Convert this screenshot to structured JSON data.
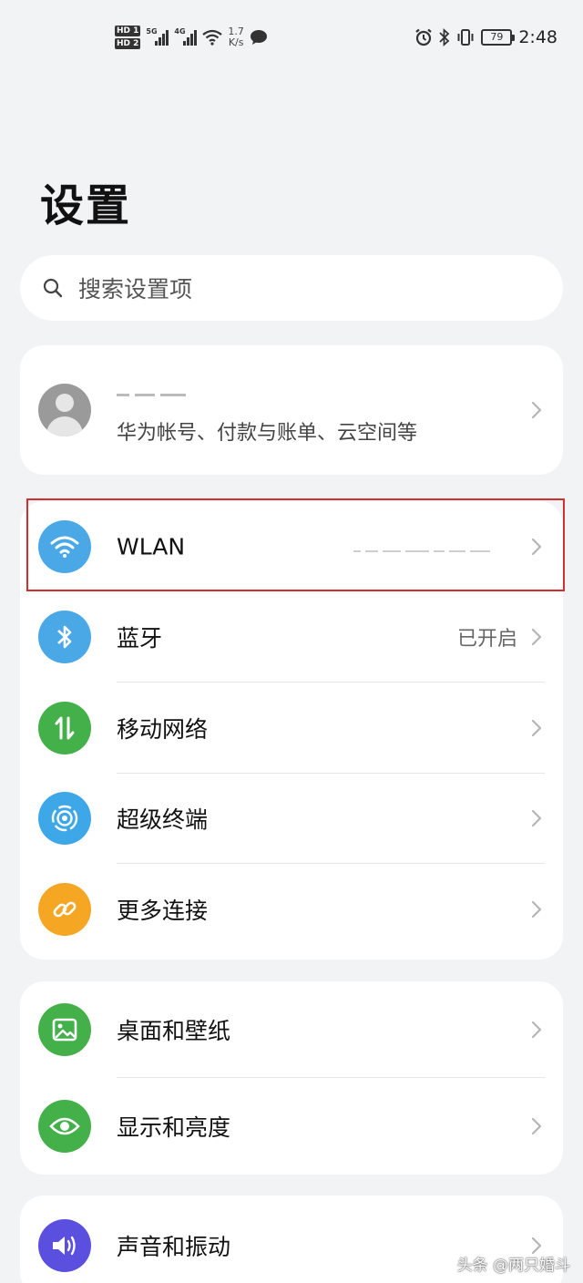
{
  "status_bar": {
    "hd1": "HD 1",
    "hd2": "HD 2",
    "sig1_label": "5G",
    "sig2_label": "4G",
    "speed_value": "1.7",
    "speed_unit": "K/s",
    "battery": "79",
    "time": "2:48"
  },
  "page": {
    "title": "设置"
  },
  "search": {
    "placeholder": "搜索设置项"
  },
  "account": {
    "subtitle": "华为帐号、付款与账单、云空间等"
  },
  "connectivity": {
    "items": [
      {
        "label": "WLAN",
        "value": "",
        "icon": "wifi-icon",
        "color": "#4aa8e6"
      },
      {
        "label": "蓝牙",
        "value": "已开启",
        "icon": "bluetooth-icon",
        "color": "#4aa8e6"
      },
      {
        "label": "移动网络",
        "value": "",
        "icon": "mobile-data-icon",
        "color": "#43b04a"
      },
      {
        "label": "超级终端",
        "value": "",
        "icon": "super-device-icon",
        "color": "#3ea7e8"
      },
      {
        "label": "更多连接",
        "value": "",
        "icon": "link-icon",
        "color": "#f5a623"
      }
    ]
  },
  "display": {
    "items": [
      {
        "label": "桌面和壁纸",
        "icon": "wallpaper-icon",
        "color": "#43b04a"
      },
      {
        "label": "显示和亮度",
        "icon": "eye-icon",
        "color": "#43b04a"
      }
    ]
  },
  "sound": {
    "items": [
      {
        "label": "声音和振动",
        "icon": "speaker-icon",
        "color": "#5b4fe0"
      }
    ]
  },
  "watermark": "头条 @两只婚斗"
}
